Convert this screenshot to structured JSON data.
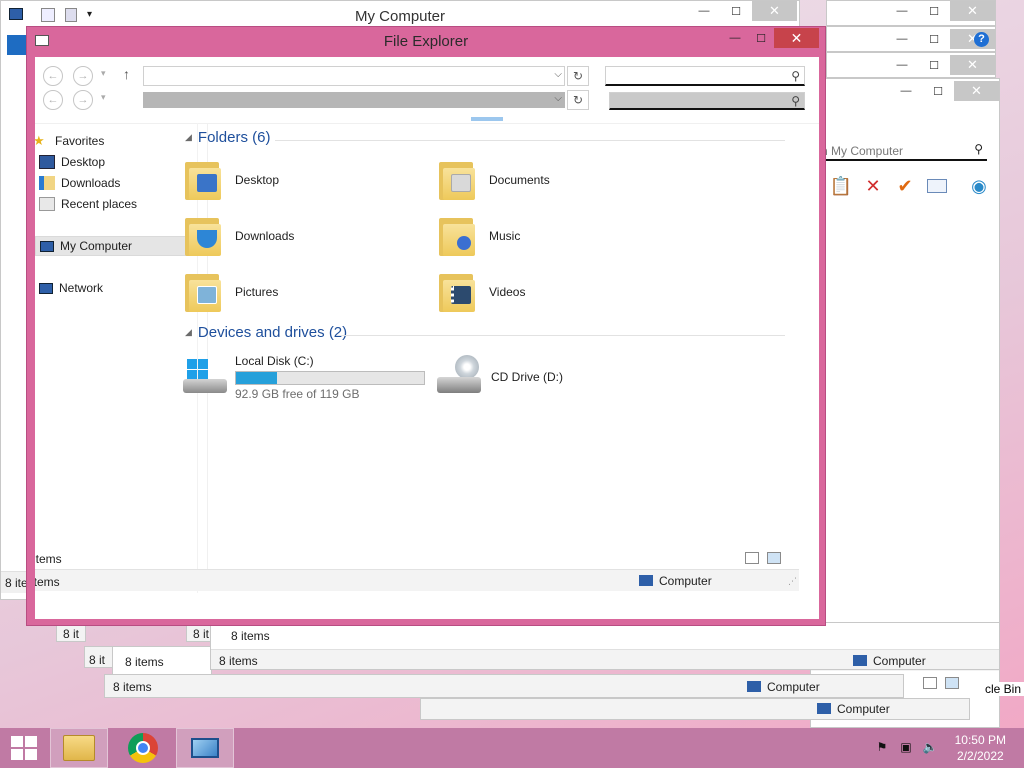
{
  "main_window": {
    "title": "File Explorer",
    "controls": {
      "minimize": "—",
      "maximize": "☐",
      "close": "✕"
    }
  },
  "back_window": {
    "title": "My Computer",
    "search_placeholder": "n My Computer",
    "status_computer": "Computer"
  },
  "nav": {
    "back": "←",
    "forward": "→",
    "up": "↑",
    "dropdown": "⌵",
    "refresh": "↻",
    "search": "⚲"
  },
  "sidebar": {
    "items": [
      {
        "label": "Favorites",
        "icon": "star-icon"
      },
      {
        "label": "Desktop",
        "icon": "desktop-icon"
      },
      {
        "label": "Downloads",
        "icon": "downloads-icon"
      },
      {
        "label": "Recent places",
        "icon": "recent-places-icon"
      },
      {
        "label": "My Computer",
        "icon": "computer-icon",
        "selected": true
      },
      {
        "label": "Network",
        "icon": "network-icon"
      }
    ]
  },
  "content": {
    "folders_header": "Folders (6)",
    "folders": [
      {
        "label": "Desktop",
        "badge_color": "#3a74c8"
      },
      {
        "label": "Documents",
        "badge_color": "#d9d9d9"
      },
      {
        "label": "Downloads",
        "badge_color": "#2d86d6"
      },
      {
        "label": "Music",
        "badge_color": "#3b6fd1"
      },
      {
        "label": "Pictures",
        "badge_color": "#7fb3d9"
      },
      {
        "label": "Videos",
        "badge_color": "#2c4a6e"
      }
    ],
    "drives_header": "Devices and drives (2)",
    "drives": [
      {
        "name": "Local Disk (C:)",
        "free": "92.9 GB free of 119 GB",
        "used_fraction": 0.22
      },
      {
        "name": "CD Drive (D:)"
      }
    ]
  },
  "status": {
    "items_count": "8 items",
    "items_count_short": "8 it",
    "computer_label": "Computer"
  },
  "desktop": {
    "recycle_bin_label": "cle Bin"
  },
  "taskbar": {
    "time": "10:50 PM",
    "date": "2/2/2022"
  },
  "colors": {
    "window_frame": "#d9679c",
    "taskbar": "#c07aa4",
    "accent_blue": "#26a0da",
    "close_red": "#c7434b",
    "header_blue": "#1e4f9c"
  }
}
